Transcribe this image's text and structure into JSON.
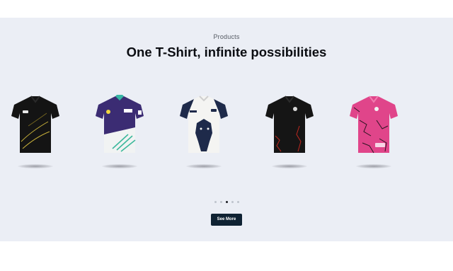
{
  "section": {
    "eyebrow": "Products",
    "headline": "One T-Shirt, infinite possibilities",
    "cta_label": "See More"
  },
  "carousel": {
    "products": [
      {
        "name": "black-gold-jersey",
        "base": "#141414",
        "accent": "#c9b23a",
        "collar": "#1e1e1e"
      },
      {
        "name": "purple-teal-jersey",
        "base": "#3b2c73",
        "accent": "#3cb89c",
        "collar": "#37b5a4"
      },
      {
        "name": "white-lion-jersey",
        "base": "#f4f4f2",
        "accent": "#1e2a4a",
        "collar": "#1e2a4a"
      },
      {
        "name": "black-red-jersey",
        "base": "#151515",
        "accent": "#b3261e",
        "collar": "#151515"
      },
      {
        "name": "pink-crackle-jersey",
        "base": "#e0458a",
        "accent": "#2a1420",
        "collar": "#e0458a"
      }
    ],
    "dot_count": 5,
    "active_dot": 2
  }
}
